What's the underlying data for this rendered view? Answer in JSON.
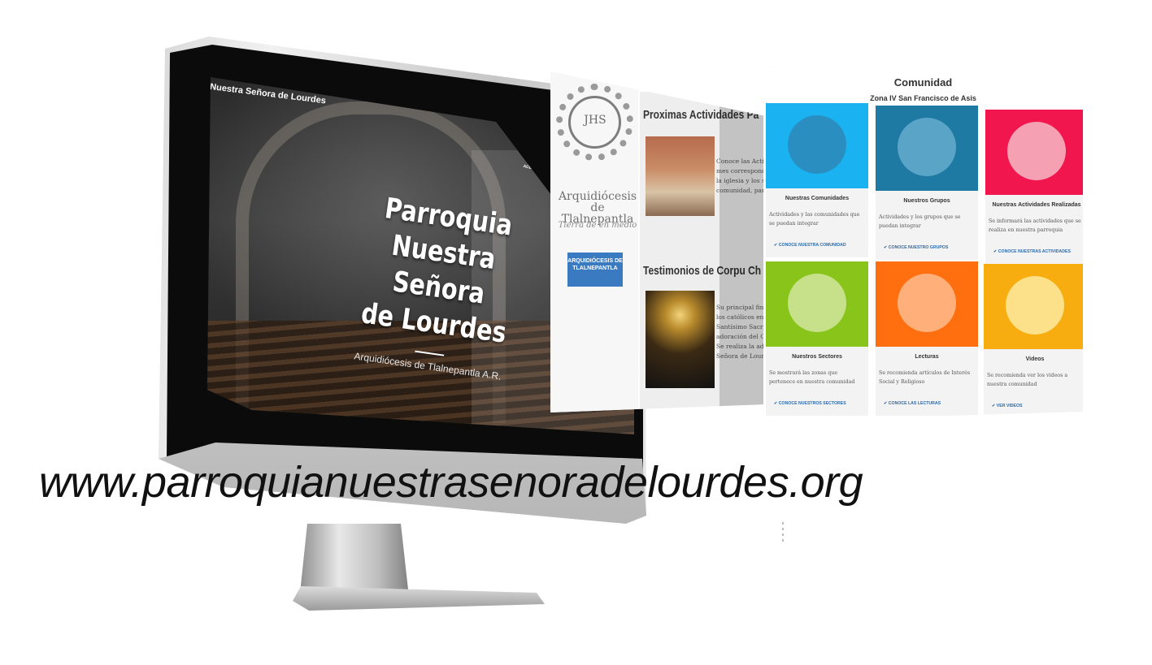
{
  "site": {
    "brand": "Nuestra Señora de Lourdes",
    "nav_link": "ACERCA DE NOSOT",
    "hero_lines": [
      "Parroquia",
      "Nuestra Señora",
      "de Lourdes"
    ],
    "hero_subtitle": "Arquidiócesis de Tlalnepantla A.R."
  },
  "arquidiocesis": {
    "seal_text": "JHS",
    "name": "Arquidiócesis de Tlalnepantla",
    "tagline": "Tierra de en medio",
    "button": "ARQUIDIÓCESIS DE TLALNEPANTLA"
  },
  "activities": {
    "heading1": "Proximas Actividades Pa",
    "text1": [
      "Conoce las Activid",
      "mes correspondiente",
      "la iglesia y los secto",
      "comunidad, para qu"
    ],
    "heading2": "Testimonios de Corpu Ch",
    "text2": [
      "Su principal finalid",
      "los católicos en la p",
      "Santísimo Sacrame",
      "adoración del Cuer",
      "Se realiza la adorac",
      "Señora de Lourdes"
    ]
  },
  "comunidad": {
    "title": "Comunidad",
    "subtitle": "Zona IV San Francisco de Asis",
    "cards": [
      {
        "title": "Nuestras Comunidades",
        "desc": "Actividades y las comunidades que se puedan integrar",
        "link": "✔ CONOCE NUESTRA COMUNIDAD",
        "color": "#1ab2f0",
        "circle": "#2a8fc0",
        "icon": "community-icon"
      },
      {
        "title": "Nuestros Grupos",
        "desc": "Actividades y los grupos que se puedan integrar",
        "link": "✔ CONOCE NUESTRO GRUPOS",
        "color": "#1f7aa3",
        "circle": "#5aa4c8",
        "icon": "group-icon"
      },
      {
        "title": "Nuestras Actividades Realizadas",
        "desc": "Se informará las actividades que se realiza en nuestra parroquia",
        "link": "✔ CONOCE NUESTRAS ACTIVIDADES",
        "color": "#f2164e",
        "circle": "#f6a0b3",
        "icon": "checklist-icon"
      },
      {
        "title": "Nuestros Sectores",
        "desc": "Se mostrará las zonas que pertenece en nuestra comunidad",
        "link": "✔ CONOCE NUESTROS SECTORES",
        "color": "#89c41a",
        "circle": "#c7e08a",
        "icon": "map-icon"
      },
      {
        "title": "Lecturas",
        "desc": "Se recomienda artículos de Interés Social y Religioso",
        "link": "✔ CONOCE LAS LECTURAS",
        "color": "#ff6f0f",
        "circle": "#ffb07a",
        "icon": "folder-icon"
      },
      {
        "title": "Videos",
        "desc": "Se recomienda ver los videos a nuestra comunidad",
        "link": "✔ VER VIDEOS",
        "color": "#f7ad0f",
        "circle": "#fde08a",
        "icon": "video-icon"
      }
    ]
  },
  "caption": {
    "url": "www.parroquianuestrasenoradelourdes.org"
  }
}
